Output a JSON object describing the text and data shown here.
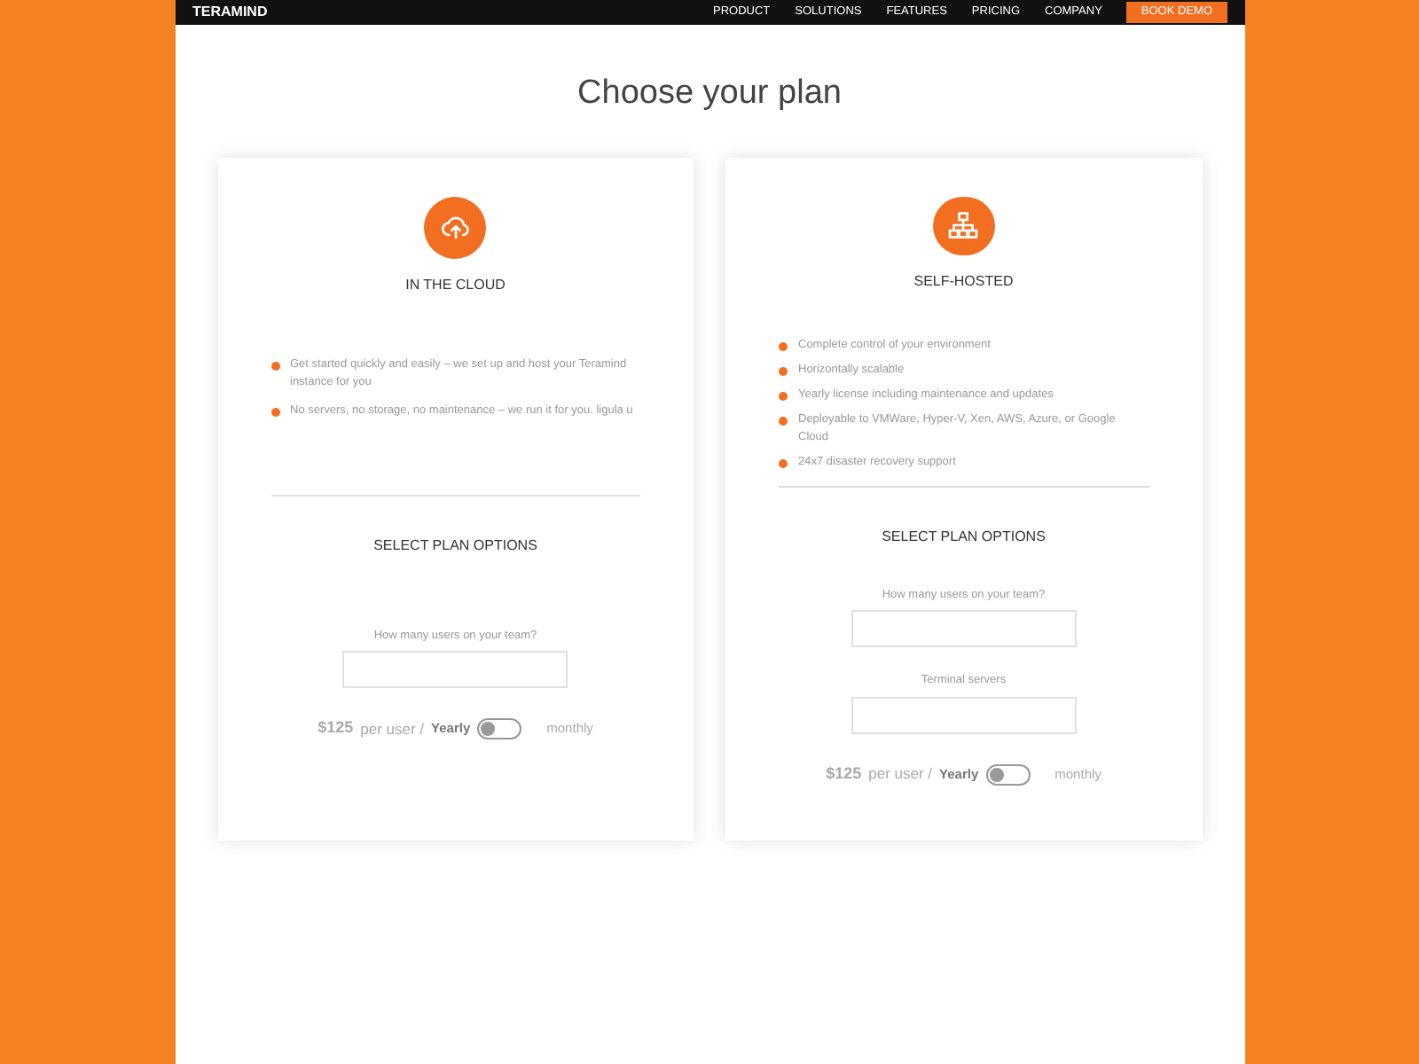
{
  "nav": {
    "logo": "TERAMIND",
    "items": [
      "PRODUCT",
      "SOLUTIONS",
      "FEATURES",
      "PRICING",
      "COMPANY"
    ],
    "cta": "BOOK DEMO"
  },
  "title": "Choose  your plan",
  "plans": [
    {
      "kind": "cloud",
      "name": "IN THE CLOUD",
      "features": [
        "Get started quickly and easily – we set up and host your Teramind instance for you",
        "No servers, no storage, no maintenance – we run it for you. ligula u"
      ],
      "options_title": "SELECT PLAN OPTIONS",
      "fields": [
        {
          "label": "How many users on your team?"
        }
      ],
      "price": "$125",
      "per": "per user /",
      "yearly": "Yearly",
      "monthly": "monthly",
      "billing_toggle": {
        "on": false
      }
    },
    {
      "kind": "server",
      "name": "SELF-HOSTED",
      "features": [
        "Complete control of your environment",
        "Horizontally scalable",
        "Yearly license including maintenance and updates",
        "Deployable to VMWare, Hyper-V, Xen, AWS, Azure, or Google Cloud",
        "24x7 disaster recovery support"
      ],
      "options_title": "SELECT PLAN OPTIONS",
      "fields": [
        {
          "label": "How many users on your team?"
        },
        {
          "label": "Terminal servers"
        }
      ],
      "price": "$125",
      "per": "per user /",
      "yearly": "Yearly",
      "monthly": "monthly",
      "billing_toggle": {
        "on": false
      }
    }
  ]
}
